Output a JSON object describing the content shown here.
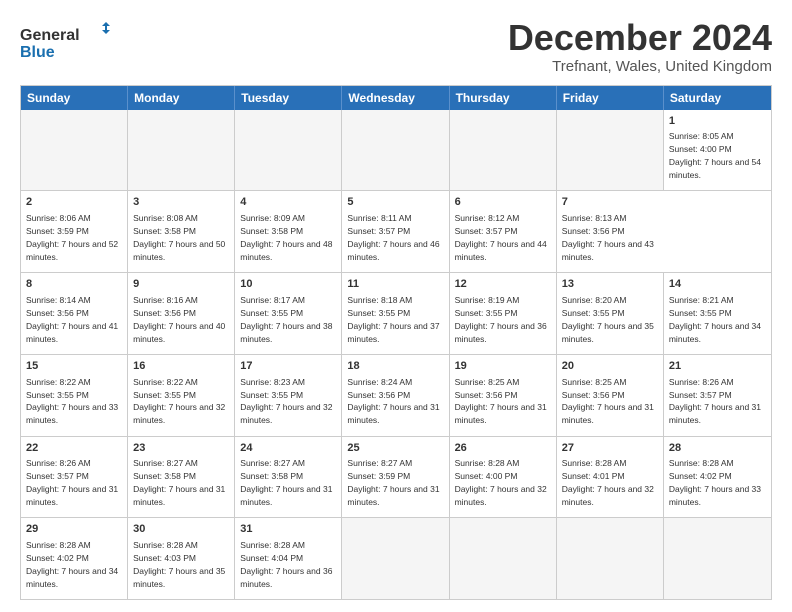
{
  "header": {
    "logo_line1": "General",
    "logo_line2": "Blue",
    "main_title": "December 2024",
    "subtitle": "Trefnant, Wales, United Kingdom"
  },
  "calendar": {
    "days_of_week": [
      "Sunday",
      "Monday",
      "Tuesday",
      "Wednesday",
      "Thursday",
      "Friday",
      "Saturday"
    ],
    "weeks": [
      [
        {
          "day": "",
          "empty": true
        },
        {
          "day": "",
          "empty": true
        },
        {
          "day": "",
          "empty": true
        },
        {
          "day": "",
          "empty": true
        },
        {
          "day": "",
          "empty": true
        },
        {
          "day": "",
          "empty": true
        },
        {
          "day": "1",
          "rise": "Sunrise: 8:05 AM",
          "set": "Sunset: 4:00 PM",
          "daylight": "Daylight: 7 hours and 54 minutes."
        }
      ],
      [
        {
          "day": "2",
          "rise": "Sunrise: 8:06 AM",
          "set": "Sunset: 3:59 PM",
          "daylight": "Daylight: 7 hours and 52 minutes."
        },
        {
          "day": "3",
          "rise": "Sunrise: 8:08 AM",
          "set": "Sunset: 3:58 PM",
          "daylight": "Daylight: 7 hours and 50 minutes."
        },
        {
          "day": "4",
          "rise": "Sunrise: 8:09 AM",
          "set": "Sunset: 3:58 PM",
          "daylight": "Daylight: 7 hours and 48 minutes."
        },
        {
          "day": "5",
          "rise": "Sunrise: 8:11 AM",
          "set": "Sunset: 3:57 PM",
          "daylight": "Daylight: 7 hours and 46 minutes."
        },
        {
          "day": "6",
          "rise": "Sunrise: 8:12 AM",
          "set": "Sunset: 3:57 PM",
          "daylight": "Daylight: 7 hours and 44 minutes."
        },
        {
          "day": "7",
          "rise": "Sunrise: 8:13 AM",
          "set": "Sunset: 3:56 PM",
          "daylight": "Daylight: 7 hours and 43 minutes."
        }
      ],
      [
        {
          "day": "8",
          "rise": "Sunrise: 8:14 AM",
          "set": "Sunset: 3:56 PM",
          "daylight": "Daylight: 7 hours and 41 minutes."
        },
        {
          "day": "9",
          "rise": "Sunrise: 8:16 AM",
          "set": "Sunset: 3:56 PM",
          "daylight": "Daylight: 7 hours and 40 minutes."
        },
        {
          "day": "10",
          "rise": "Sunrise: 8:17 AM",
          "set": "Sunset: 3:55 PM",
          "daylight": "Daylight: 7 hours and 38 minutes."
        },
        {
          "day": "11",
          "rise": "Sunrise: 8:18 AM",
          "set": "Sunset: 3:55 PM",
          "daylight": "Daylight: 7 hours and 37 minutes."
        },
        {
          "day": "12",
          "rise": "Sunrise: 8:19 AM",
          "set": "Sunset: 3:55 PM",
          "daylight": "Daylight: 7 hours and 36 minutes."
        },
        {
          "day": "13",
          "rise": "Sunrise: 8:20 AM",
          "set": "Sunset: 3:55 PM",
          "daylight": "Daylight: 7 hours and 35 minutes."
        },
        {
          "day": "14",
          "rise": "Sunrise: 8:21 AM",
          "set": "Sunset: 3:55 PM",
          "daylight": "Daylight: 7 hours and 34 minutes."
        }
      ],
      [
        {
          "day": "15",
          "rise": "Sunrise: 8:22 AM",
          "set": "Sunset: 3:55 PM",
          "daylight": "Daylight: 7 hours and 33 minutes."
        },
        {
          "day": "16",
          "rise": "Sunrise: 8:22 AM",
          "set": "Sunset: 3:55 PM",
          "daylight": "Daylight: 7 hours and 32 minutes."
        },
        {
          "day": "17",
          "rise": "Sunrise: 8:23 AM",
          "set": "Sunset: 3:55 PM",
          "daylight": "Daylight: 7 hours and 32 minutes."
        },
        {
          "day": "18",
          "rise": "Sunrise: 8:24 AM",
          "set": "Sunset: 3:56 PM",
          "daylight": "Daylight: 7 hours and 31 minutes."
        },
        {
          "day": "19",
          "rise": "Sunrise: 8:25 AM",
          "set": "Sunset: 3:56 PM",
          "daylight": "Daylight: 7 hours and 31 minutes."
        },
        {
          "day": "20",
          "rise": "Sunrise: 8:25 AM",
          "set": "Sunset: 3:56 PM",
          "daylight": "Daylight: 7 hours and 31 minutes."
        },
        {
          "day": "21",
          "rise": "Sunrise: 8:26 AM",
          "set": "Sunset: 3:57 PM",
          "daylight": "Daylight: 7 hours and 31 minutes."
        }
      ],
      [
        {
          "day": "22",
          "rise": "Sunrise: 8:26 AM",
          "set": "Sunset: 3:57 PM",
          "daylight": "Daylight: 7 hours and 31 minutes."
        },
        {
          "day": "23",
          "rise": "Sunrise: 8:27 AM",
          "set": "Sunset: 3:58 PM",
          "daylight": "Daylight: 7 hours and 31 minutes."
        },
        {
          "day": "24",
          "rise": "Sunrise: 8:27 AM",
          "set": "Sunset: 3:58 PM",
          "daylight": "Daylight: 7 hours and 31 minutes."
        },
        {
          "day": "25",
          "rise": "Sunrise: 8:27 AM",
          "set": "Sunset: 3:59 PM",
          "daylight": "Daylight: 7 hours and 31 minutes."
        },
        {
          "day": "26",
          "rise": "Sunrise: 8:28 AM",
          "set": "Sunset: 4:00 PM",
          "daylight": "Daylight: 7 hours and 32 minutes."
        },
        {
          "day": "27",
          "rise": "Sunrise: 8:28 AM",
          "set": "Sunset: 4:01 PM",
          "daylight": "Daylight: 7 hours and 32 minutes."
        },
        {
          "day": "28",
          "rise": "Sunrise: 8:28 AM",
          "set": "Sunset: 4:02 PM",
          "daylight": "Daylight: 7 hours and 33 minutes."
        }
      ],
      [
        {
          "day": "29",
          "rise": "Sunrise: 8:28 AM",
          "set": "Sunset: 4:02 PM",
          "daylight": "Daylight: 7 hours and 34 minutes."
        },
        {
          "day": "30",
          "rise": "Sunrise: 8:28 AM",
          "set": "Sunset: 4:03 PM",
          "daylight": "Daylight: 7 hours and 35 minutes."
        },
        {
          "day": "31",
          "rise": "Sunrise: 8:28 AM",
          "set": "Sunset: 4:04 PM",
          "daylight": "Daylight: 7 hours and 36 minutes."
        },
        {
          "day": "",
          "empty": true
        },
        {
          "day": "",
          "empty": true
        },
        {
          "day": "",
          "empty": true
        },
        {
          "day": "",
          "empty": true
        }
      ]
    ]
  }
}
